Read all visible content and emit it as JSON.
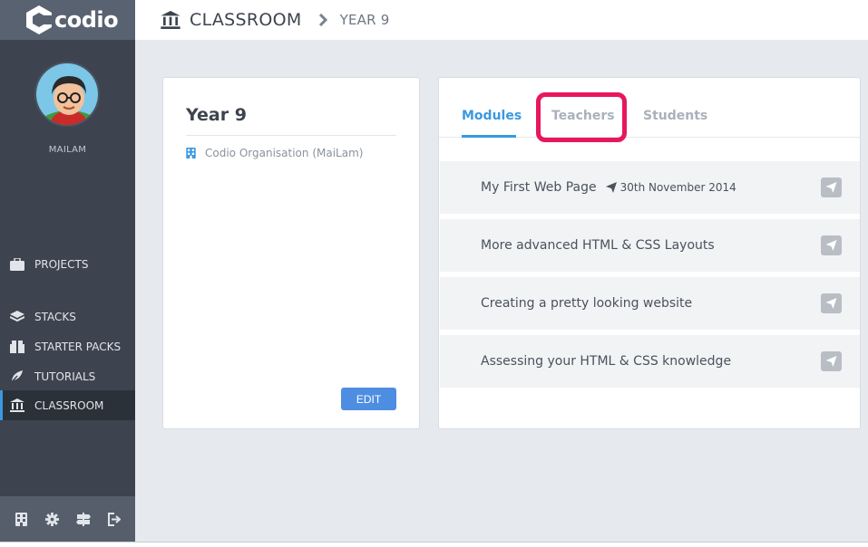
{
  "app": {
    "logo_text": "codio"
  },
  "sidebar": {
    "username": "MAILAM",
    "items": [
      {
        "label": "PROJECTS",
        "icon": "briefcase-icon"
      },
      {
        "label": "STACKS",
        "icon": "layers-icon"
      },
      {
        "label": "STARTER PACKS",
        "icon": "package-icon"
      },
      {
        "label": "TUTORIALS",
        "icon": "tutorial-icon"
      },
      {
        "label": "CLASSROOM",
        "icon": "classroom-icon",
        "active": true
      }
    ],
    "footer_icons": [
      "organization-icon",
      "gear-icon",
      "signpost-icon",
      "logout-icon"
    ]
  },
  "header": {
    "breadcrumb": [
      "CLASSROOM",
      "YEAR 9"
    ]
  },
  "class_card": {
    "title": "Year 9",
    "organisation": "Codio Organisation (MaiLam)",
    "edit_label": "EDIT"
  },
  "tabs": [
    {
      "label": "Modules",
      "active": true
    },
    {
      "label": "Teachers"
    },
    {
      "label": "Students"
    }
  ],
  "modules": [
    {
      "name": "My First Web Page",
      "date": "30th November 2014"
    },
    {
      "name": "More advanced HTML & CSS Layouts"
    },
    {
      "name": "Creating a pretty looking website"
    },
    {
      "name": "Assessing your HTML & CSS knowledge"
    }
  ],
  "colors": {
    "accent": "#3b98e0",
    "sidebar": "#3d444f",
    "highlight": "#e8175d",
    "button": "#4e8ee2"
  }
}
